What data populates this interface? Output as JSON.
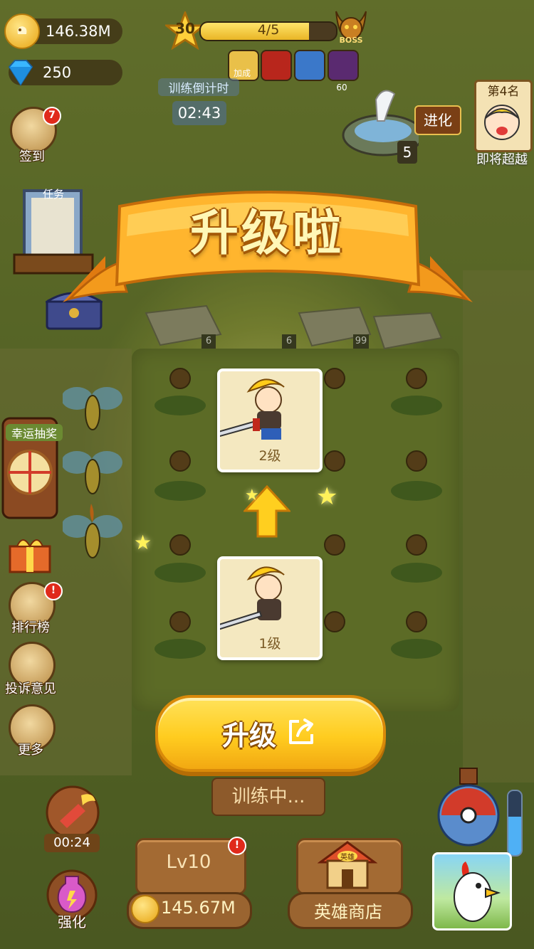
{
  "resources": {
    "gold": "146.38M",
    "gems": "250"
  },
  "level": {
    "number": "30",
    "progress_text": "4/5",
    "progress_fraction": 0.8,
    "boss_label": "BOSS"
  },
  "buffs": {
    "bonus_label": "加成",
    "count": "60"
  },
  "countdown": {
    "title": "训练倒计时",
    "time": "02:43"
  },
  "rank": {
    "title": "第4名",
    "subtitle": "即将超越"
  },
  "evolve": {
    "label": "进化",
    "count": "5"
  },
  "sidebar": {
    "checkin": "签到",
    "checkin_badge": "7",
    "task": "任务",
    "lucky_draw": "幸运抽奖",
    "leaderboard": "排行榜",
    "feedback": "投诉意见",
    "more": "更多"
  },
  "popup": {
    "title": "升级啦",
    "after_level": "2级",
    "before_level": "1级",
    "upgrade_button": "升级"
  },
  "field": {
    "slot_counts": [
      "6",
      "6",
      "99"
    ]
  },
  "bottom": {
    "training": "训练中...",
    "timer": "00:24",
    "strengthen": "强化",
    "level_panel": "Lv10",
    "coin_amount": "145.67M",
    "hero_shop": "英雄商店",
    "shop_sign": "英雄"
  },
  "colors": {
    "accent_yellow": "#ffcc1f",
    "banner_orange": "#f39a1c",
    "panel_brown": "#a36a33"
  }
}
